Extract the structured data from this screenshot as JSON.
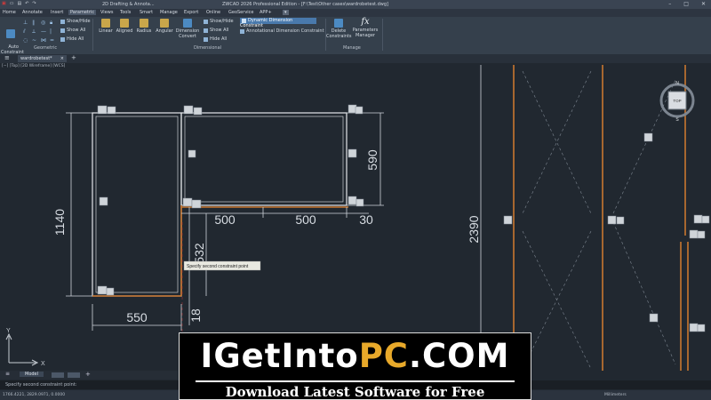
{
  "titlebar": {
    "workspace": "2D Drafting & Annota...",
    "title": "ZWCAD 2026 Professional Edition - [F:\\Test\\Other cases\\wardrobetest.dwg]",
    "window_controls": [
      "minimize-icon",
      "maximize-icon",
      "close-icon"
    ]
  },
  "menubar": {
    "items": [
      "Home",
      "Annotate",
      "Insert",
      "Parametric",
      "Views",
      "Tools",
      "Smart",
      "Manage",
      "Export",
      "Online",
      "GeoService",
      "APP+"
    ],
    "active": "Parametric"
  },
  "ribbon": {
    "auto_constraint": "Auto\nConstraint",
    "geometric_show_hide": "Show/Hide",
    "geometric_show_all": "Show All",
    "geometric_hide_all": "Hide All",
    "geometric_label": "Geometric",
    "linear": "Linear",
    "aligned": "Aligned",
    "radius": "Radius",
    "angular": "Angular",
    "dimension_convert": "Dimension\nConvert",
    "dim_show_hide": "Show/Hide",
    "dim_show_all": "Show All",
    "dim_hide_all": "Hide All",
    "dynamic_constraint": "Dynamic Dimension Constraint",
    "annotational_constraint": "Annotational Dimension Constraint",
    "dimensional_label": "Dimensional",
    "delete_constraints": "Delete\nConstraints",
    "parameters_manager": "Parameters\nManager",
    "fx": "fx",
    "manage_label": "Manage"
  },
  "doc_tab": "wardrobetest*",
  "view_label": "[−] [Top] [2D Wireframe] [WCS]",
  "drawing": {
    "dims": [
      "1140",
      "590",
      "500",
      "500",
      "30",
      "532",
      "550",
      "18",
      "2390"
    ],
    "tooltip": "Specify second constraint point"
  },
  "ucs": {
    "x": "X",
    "y": "Y"
  },
  "navcube": {
    "n": "N",
    "top": "TOP",
    "s": "S"
  },
  "layout_tabs": [
    "Model"
  ],
  "command": "Specify second constraint point:",
  "status": {
    "coords": "1766.4221, 2829.0971, 0.0000",
    "units": "Millimeters"
  },
  "banner": {
    "line1_a": "IGetInto",
    "line1_b": "PC",
    "line1_c": ".COM",
    "line2": "Download Latest Software for Free"
  },
  "colors": {
    "canvas": "#212830",
    "wall": "#c9772f",
    "geometry": "#e3e6ea",
    "accent": "#e8a92a"
  }
}
